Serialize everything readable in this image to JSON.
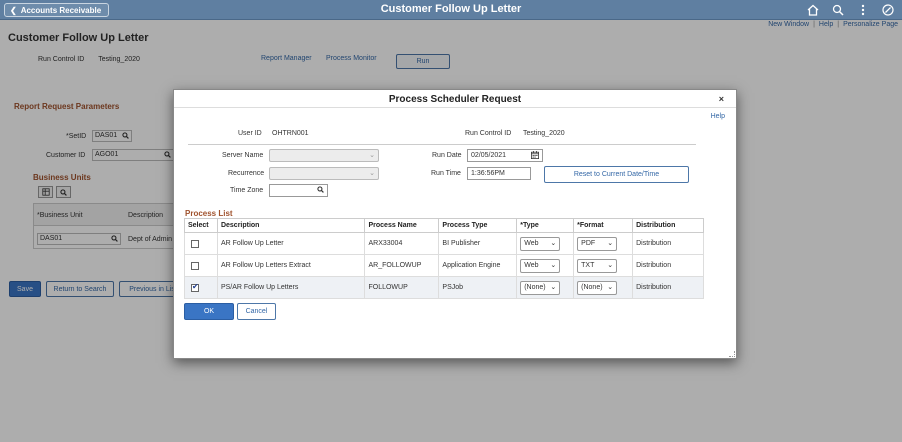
{
  "banner": {
    "back_label": "Accounts Receivable",
    "title": "Customer Follow Up Letter",
    "icons": [
      "home-icon",
      "search-icon",
      "more-icon",
      "navbar-icon"
    ]
  },
  "top_links": {
    "new_window": "New Window",
    "help": "Help",
    "personalize": "Personalize Page",
    "sep": "|"
  },
  "page": {
    "title": "Customer Follow Up Letter",
    "run_control_label": "Run Control ID",
    "run_control_value": "Testing_2020",
    "report_manager": "Report Manager",
    "process_monitor": "Process Monitor",
    "run_label": "Run"
  },
  "params": {
    "heading": "Report Request Parameters",
    "setid_label": "*SetID",
    "setid_value": "DAS01",
    "customer_label": "Customer ID",
    "customer_value": "AGO01",
    "business_units_heading": "Business Units",
    "bu_col": "*Business Unit",
    "desc_col": "Description",
    "bu_value": "DAS01",
    "desc_value": "Dept of Admin"
  },
  "bottom_buttons": {
    "save": "Save",
    "return": "Return to Search",
    "previous": "Previous in List"
  },
  "modal": {
    "title": "Process Scheduler Request",
    "close": "×",
    "help": "Help",
    "user_id_label": "User ID",
    "user_id_value": "OHTRN001",
    "run_control_label": "Run Control ID",
    "run_control_value": "Testing_2020",
    "server_name_label": "Server Name",
    "recurrence_label": "Recurrence",
    "time_zone_label": "Time Zone",
    "run_date_label": "Run Date",
    "run_date_value": "02/05/2021",
    "run_time_label": "Run Time",
    "run_time_value": "1:36:56PM",
    "reset_label": "Reset to Current Date/Time",
    "process_list_heading": "Process List",
    "columns": [
      "Select",
      "Description",
      "Process Name",
      "Process Type",
      "*Type",
      "*Format",
      "Distribution"
    ],
    "rows": [
      {
        "checked": false,
        "description": "AR Follow Up Letter",
        "process_name": "ARX33004",
        "process_type": "BI Publisher",
        "type": "Web",
        "format": "PDF",
        "distribution": "Distribution"
      },
      {
        "checked": false,
        "description": "AR Follow Up Letters Extract",
        "process_name": "AR_FOLLOWUP",
        "process_type": "Application Engine",
        "type": "Web",
        "format": "TXT",
        "distribution": "Distribution"
      },
      {
        "checked": true,
        "description": "PS/AR Follow Up Letters",
        "process_name": "FOLLOWUP",
        "process_type": "PSJob",
        "type": "(None)",
        "format": "(None)",
        "distribution": "Distribution"
      }
    ],
    "ok_label": "OK",
    "cancel_label": "Cancel"
  },
  "colors": {
    "banner": "#5f7fa1",
    "link": "#3367a6",
    "section_heading": "#a0522d",
    "primary_button": "#3a75c4"
  }
}
